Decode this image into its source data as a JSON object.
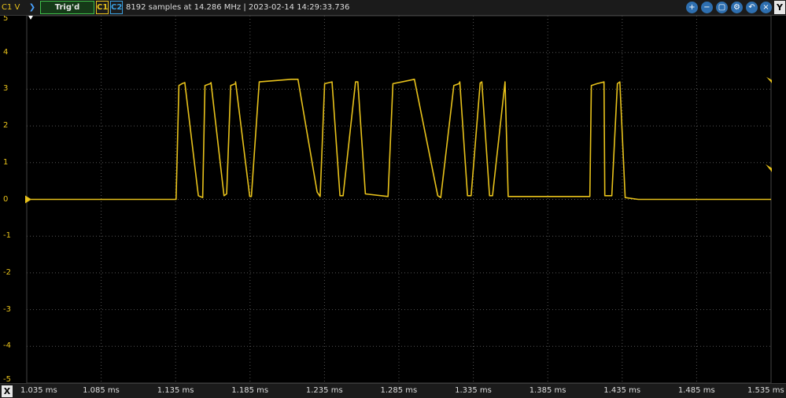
{
  "toolbar": {
    "channel_axis_label": "C1 V",
    "play_icon": "play-arrow-icon",
    "trigger_status": "Trig'd",
    "channel1": "C1",
    "channel2": "C2",
    "acquisition_info": "8192 samples at 14.286 MHz | 2023-02-14 14:29:33.736",
    "tool_icons": [
      "zoom-in-icon",
      "zoom-out-icon",
      "zoom-fit-icon",
      "settings-icon",
      "close-icon"
    ],
    "y_axis_button": "Y"
  },
  "footer": {
    "x_axis_button": "X"
  },
  "colors": {
    "trace": "#e8c21b",
    "grid": "#555555",
    "background": "#000000"
  },
  "chart_data": {
    "type": "line",
    "title": "",
    "xlabel": "",
    "ylabel": "C1 V",
    "x_unit": "ms",
    "xlim": [
      1.035,
      1.535
    ],
    "ylim": [
      -5,
      5
    ],
    "grid": true,
    "x_tick_labels": [
      "1.035 ms",
      "1.085 ms",
      "1.135 ms",
      "1.185 ms",
      "1.235 ms",
      "1.285 ms",
      "1.335 ms",
      "1.385 ms",
      "1.435 ms",
      "1.485 ms",
      "1.535 ms"
    ],
    "y_tick_labels": [
      "5",
      "4",
      "3",
      "2",
      "1",
      "0",
      "-1",
      "-2",
      "-3",
      "-4",
      "-5"
    ],
    "series": [
      {
        "color": "#e8c21b",
        "x": [
          1.035,
          1.1353,
          1.1372,
          1.1393,
          1.1412,
          1.1503,
          1.1532,
          1.1547,
          1.1582,
          1.1588,
          1.1675,
          1.1693,
          1.172,
          1.1753,
          1.1753,
          1.1848,
          1.1859,
          1.1912,
          1.2128,
          1.2172,
          1.2301,
          1.2321,
          1.2351,
          1.2401,
          1.2454,
          1.2475,
          1.2559,
          1.2574,
          1.2625,
          1.2777,
          1.281,
          1.2954,
          1.3111,
          1.3131,
          1.3219,
          1.3254,
          1.3259,
          1.3311,
          1.3335,
          1.3396,
          1.3407,
          1.3459,
          1.3479,
          1.3563,
          1.3584,
          1.4133,
          1.4143,
          1.4181,
          1.4228,
          1.4233,
          1.428,
          1.4318,
          1.4334,
          1.437,
          1.4458,
          1.535
        ],
        "y": [
          0.0,
          0.0,
          3.1,
          3.15,
          3.18,
          0.1,
          0.05,
          3.1,
          3.15,
          3.18,
          0.1,
          0.15,
          3.1,
          3.15,
          3.2,
          0.08,
          0.08,
          3.2,
          3.27,
          3.27,
          0.2,
          0.08,
          3.15,
          3.2,
          0.1,
          0.1,
          3.2,
          3.2,
          0.15,
          0.08,
          3.15,
          3.27,
          0.1,
          0.05,
          3.1,
          3.15,
          3.2,
          0.1,
          0.1,
          3.17,
          3.2,
          0.1,
          0.1,
          3.2,
          0.08,
          0.08,
          3.1,
          3.15,
          3.2,
          0.1,
          0.1,
          3.15,
          3.2,
          0.05,
          0.0,
          0.0
        ]
      }
    ]
  }
}
